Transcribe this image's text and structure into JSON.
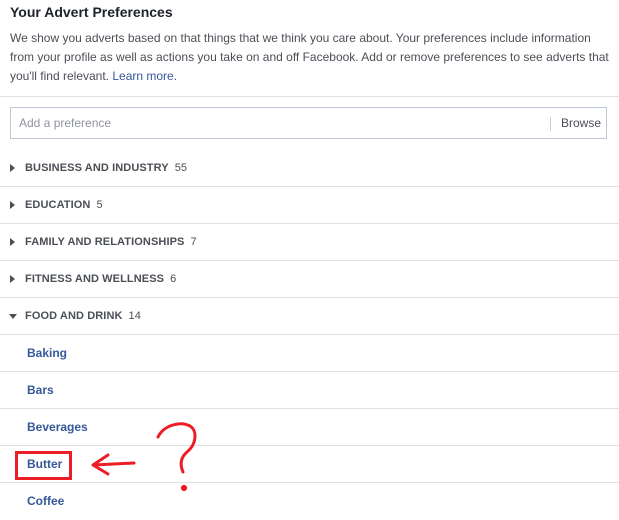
{
  "header": {
    "title": "Your Advert Preferences",
    "description": "We show you adverts based on that things that we think you care about. Your preferences include information from your profile as well as actions you take on and off Facebook. Add or remove preferences to see adverts that you'll find relevant.",
    "learn_more": "Learn more."
  },
  "search": {
    "placeholder": "Add a preference",
    "value": "",
    "browse_label": "Browse"
  },
  "categories": [
    {
      "label": "BUSINESS AND INDUSTRY",
      "count": "55",
      "expanded": false
    },
    {
      "label": "EDUCATION",
      "count": "5",
      "expanded": false
    },
    {
      "label": "FAMILY AND RELATIONSHIPS",
      "count": "7",
      "expanded": false
    },
    {
      "label": "FITNESS AND WELLNESS",
      "count": "6",
      "expanded": false
    },
    {
      "label": "FOOD AND DRINK",
      "count": "14",
      "expanded": true
    }
  ],
  "food_and_drink_items": [
    "Baking",
    "Bars",
    "Beverages",
    "Butter",
    "Coffee"
  ],
  "annotation": {
    "highlighted_item": "Butter",
    "question_mark": "?",
    "color": "#ee1c25"
  },
  "colors": {
    "link": "#365899",
    "text": "#4b4f56",
    "divider": "#dddfe2"
  }
}
